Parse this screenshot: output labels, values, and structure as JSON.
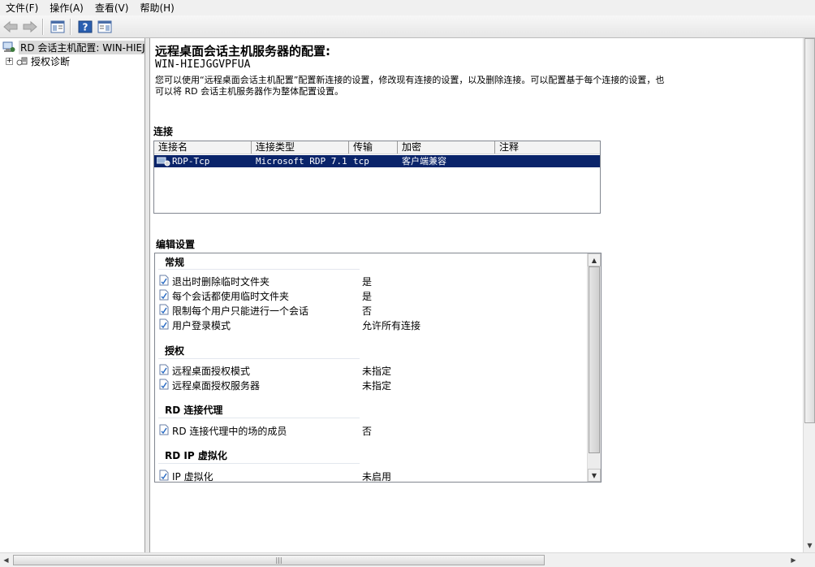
{
  "menu": [
    "文件(F)",
    "操作(A)",
    "查看(V)",
    "帮助(H)"
  ],
  "tree": {
    "root": "RD 会话主机配置: WIN-HIEJGGVPFUA",
    "child": "授权诊断"
  },
  "main": {
    "title": "远程桌面会话主机服务器的配置:",
    "server": "WIN-HIEJGGVPFUA",
    "description": "您可以使用“远程桌面会话主机配置”配置新连接的设置，修改现有连接的设置，以及删除连接。可以配置基于每个连接的设置，也可以将 RD 会话主机服务器作为整体配置设置。"
  },
  "connections": {
    "heading": "连接",
    "columns": [
      "连接名",
      "连接类型",
      "传输",
      "加密",
      "注释"
    ],
    "rows": [
      {
        "name": "RDP-Tcp",
        "type": "Microsoft RDP 7.1",
        "transport": "tcp",
        "encryption": "客户端兼容",
        "comment": ""
      }
    ]
  },
  "edit": {
    "heading": "编辑设置",
    "groups": [
      {
        "title": "常规",
        "items": [
          {
            "label": "退出时删除临时文件夹",
            "value": "是"
          },
          {
            "label": "每个会话都使用临时文件夹",
            "value": "是"
          },
          {
            "label": "限制每个用户只能进行一个会话",
            "value": "否"
          },
          {
            "label": "用户登录模式",
            "value": "允许所有连接"
          }
        ]
      },
      {
        "title": "授权",
        "items": [
          {
            "label": "远程桌面授权模式",
            "value": "未指定"
          },
          {
            "label": "远程桌面授权服务器",
            "value": "未指定"
          }
        ]
      },
      {
        "title": "RD 连接代理",
        "items": [
          {
            "label": "RD 连接代理中的场的成员",
            "value": "否"
          }
        ]
      },
      {
        "title": "RD IP 虚拟化",
        "items": [
          {
            "label": "IP 虚拟化",
            "value": "未启用"
          }
        ]
      }
    ]
  },
  "colors": {
    "selection": "#0a246a",
    "menubar": "#f0f0f0"
  }
}
